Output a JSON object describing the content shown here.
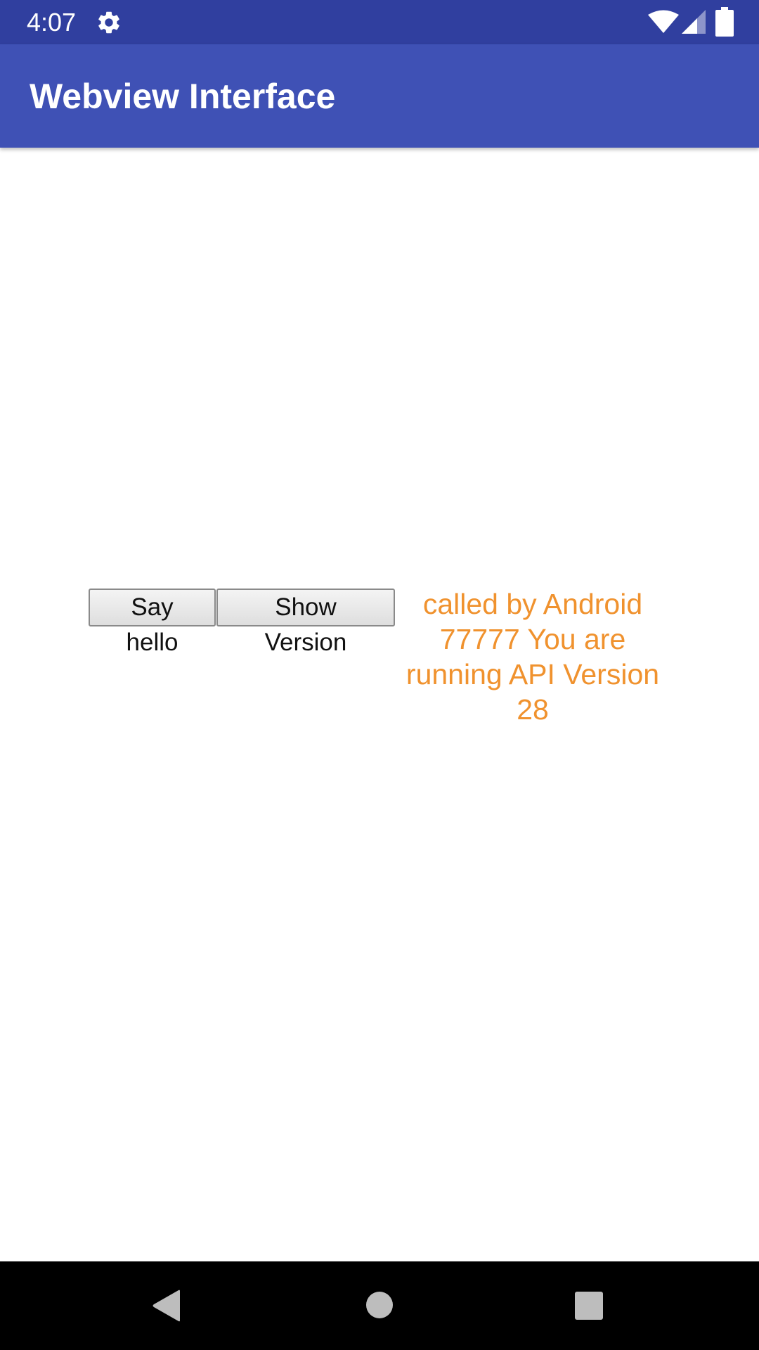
{
  "status_bar": {
    "time": "4:07",
    "icons": [
      "settings-icon",
      "wifi-icon",
      "signal-icon",
      "battery-icon"
    ]
  },
  "app_bar": {
    "title": "Webview Interface"
  },
  "webview": {
    "say_hello_label": "Say hello",
    "show_version_label": "Show Version",
    "output_text": "called by Android 77777 You are running API Version 28"
  },
  "nav_bar": {
    "icons": [
      "back-icon",
      "home-icon",
      "recents-icon"
    ]
  },
  "colors": {
    "status_bar": "#303F9F",
    "app_bar": "#3F51B5",
    "output_text": "#F0922E",
    "nav_bar": "#000000"
  }
}
